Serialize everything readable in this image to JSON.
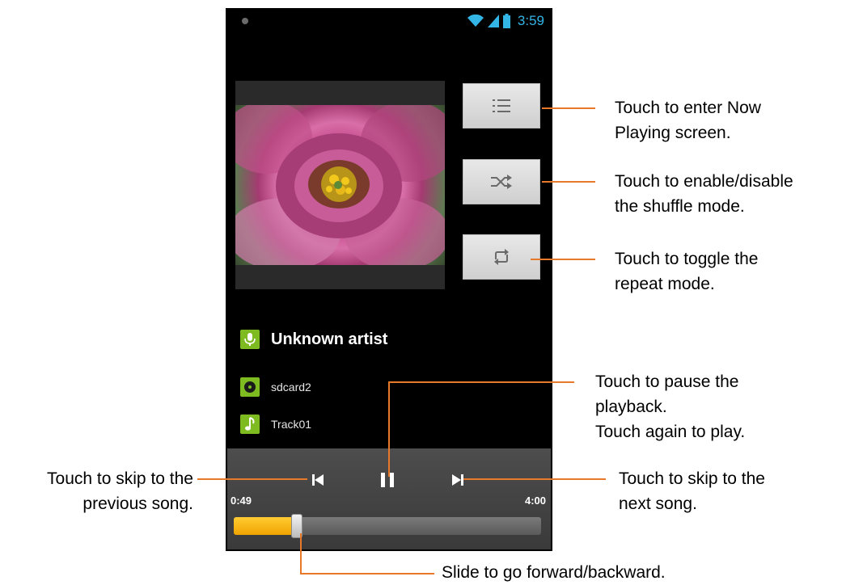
{
  "status_bar": {
    "time": "3:59",
    "icons": [
      "wifi-icon",
      "signal-icon",
      "battery-icon"
    ]
  },
  "track": {
    "artist": "Unknown artist",
    "album": "sdcard2",
    "title": "Track01"
  },
  "side_buttons": [
    "playlist-icon",
    "shuffle-icon",
    "repeat-icon"
  ],
  "playback": {
    "elapsed": "0:49",
    "duration": "4:00",
    "progress_fraction": 0.205,
    "controls": [
      "previous-icon",
      "pause-icon",
      "next-icon"
    ]
  },
  "callouts": {
    "now_playing": [
      "Touch to enter Now",
      "Playing screen."
    ],
    "shuffle": [
      "Touch to enable/disable",
      "the shuffle mode."
    ],
    "repeat": [
      "Touch to toggle the",
      "repeat mode."
    ],
    "pause": [
      "Touch to pause the",
      "playback.",
      "Touch again to play."
    ],
    "previous": [
      "Touch to skip to the",
      "previous song."
    ],
    "next": [
      "Touch to skip to the",
      "next song."
    ],
    "seek": [
      "Slide to go forward/backward."
    ]
  },
  "colors": {
    "callout_line": "#e8782a",
    "status_time": "#33b5e5",
    "seek_fill": "#f0a300",
    "info_icon_bg": "#7dbb21"
  }
}
